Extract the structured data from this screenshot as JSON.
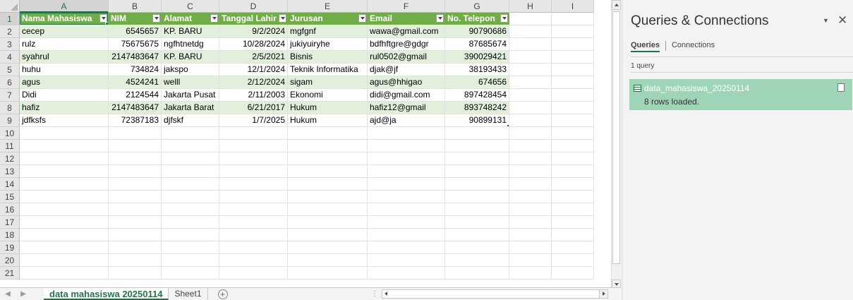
{
  "sheet": {
    "columns": [
      "A",
      "B",
      "C",
      "D",
      "E",
      "F",
      "G",
      "H",
      "I"
    ],
    "row_numbers": [
      "1",
      "2",
      "3",
      "4",
      "5",
      "6",
      "7",
      "8",
      "9",
      "10",
      "11",
      "12",
      "13",
      "14",
      "15",
      "16",
      "17",
      "18",
      "19",
      "20",
      "21"
    ],
    "table": {
      "headers": [
        "Nama Mahasiswa",
        "NIM",
        "Alamat",
        "Tanggal Lahir",
        "Jurusan",
        "Email",
        "No. Telepon"
      ],
      "rows": [
        [
          "cecep",
          "6545657",
          "KP. BARU",
          "9/2/2024",
          "mgfgnf",
          "wawa@gmail.com",
          "90790686"
        ],
        [
          "rulz",
          "75675675",
          "ngfhtnetdg",
          "10/28/2024",
          "jukiyuiryhe",
          "bdfhftgre@gdgr",
          "87685674"
        ],
        [
          "syahrul",
          "2147483647",
          "KP. BARU",
          "2/5/2021",
          "Bisnis",
          "rul0502@gmail",
          "390029421"
        ],
        [
          "huhu",
          "734824",
          "jakspo",
          "12/1/2024",
          "Teknik Informatika",
          "djak@jf",
          "38193433"
        ],
        [
          "agus",
          "4524241",
          "welll",
          "2/12/2024",
          "sigam",
          "agus@hhigao",
          "674656"
        ],
        [
          "Didi",
          "2124544",
          "Jakarta Pusat",
          "2/11/2003",
          "Ekonomi",
          "didi@gmail.com",
          "897428454"
        ],
        [
          "hafiz",
          "2147483647",
          "Jakarta Barat",
          "6/21/2017",
          "Hukum",
          "hafiz12@gmail",
          "893748242"
        ],
        [
          "jdfksfs",
          "72387183",
          "djfskf",
          "1/7/2025",
          "Hukum",
          "ajd@ja",
          "90899131"
        ]
      ]
    },
    "tabs": {
      "active": "data mahasiswa 20250114",
      "other": "Sheet1",
      "add": "+"
    }
  },
  "pane": {
    "title": "Queries & Connections",
    "dropdown": "▼",
    "close": "✕",
    "tab_queries": "Queries",
    "tab_connections": "Connections",
    "count": "1 query",
    "query_name": "data_mahasiswa_20250114",
    "query_status": "8 rows loaded."
  },
  "colors": {
    "header_fill": "#70ad47",
    "band_fill": "#e2efda",
    "accent": "#217346",
    "query_highlight": "#9fd5b7"
  }
}
